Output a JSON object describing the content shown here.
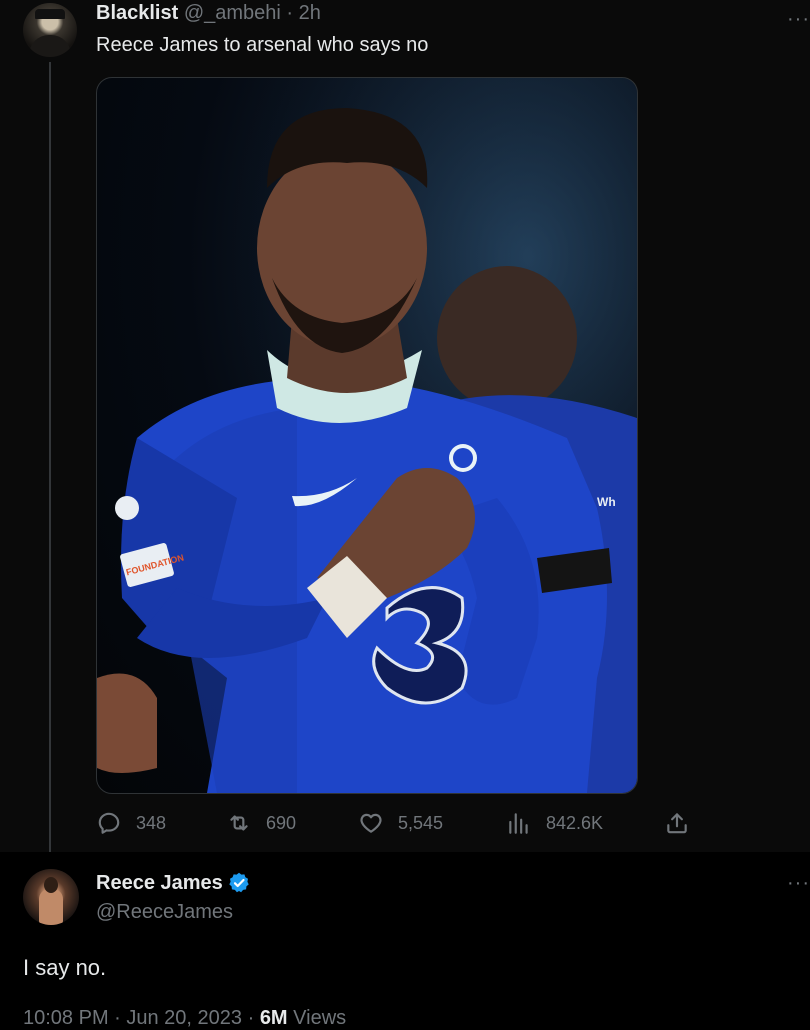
{
  "tweet1": {
    "author_name": "Blacklist",
    "handle": "@_ambehi",
    "time": "· 2h",
    "text": "Reece James to arsenal who says no",
    "replies": "348",
    "retweets": "690",
    "likes": "5,545",
    "views": "842.6K",
    "more": "···"
  },
  "tweet2": {
    "author_name": "Reece James",
    "handle": "@ReeceJames",
    "text": "I say no.",
    "meta_time": "10:08 PM · Jun 20, 2023 · ",
    "meta_views_count": "6M",
    "meta_views_label": " Views",
    "more": "···"
  },
  "photo_text": {
    "sleeve_patch": "FOUNDATION",
    "sponsor": "Wh"
  },
  "colors": {
    "background": "#000000",
    "card_background": "#0a0a0a",
    "text_primary": "#e7e9ea",
    "text_secondary": "#71767b",
    "verified": "#1d9bf0",
    "jersey_blue": "#1e45c8"
  },
  "icons": [
    "reply-icon",
    "retweet-icon",
    "like-icon",
    "views-icon",
    "share-icon",
    "verified-badge-icon",
    "more-icon"
  ]
}
